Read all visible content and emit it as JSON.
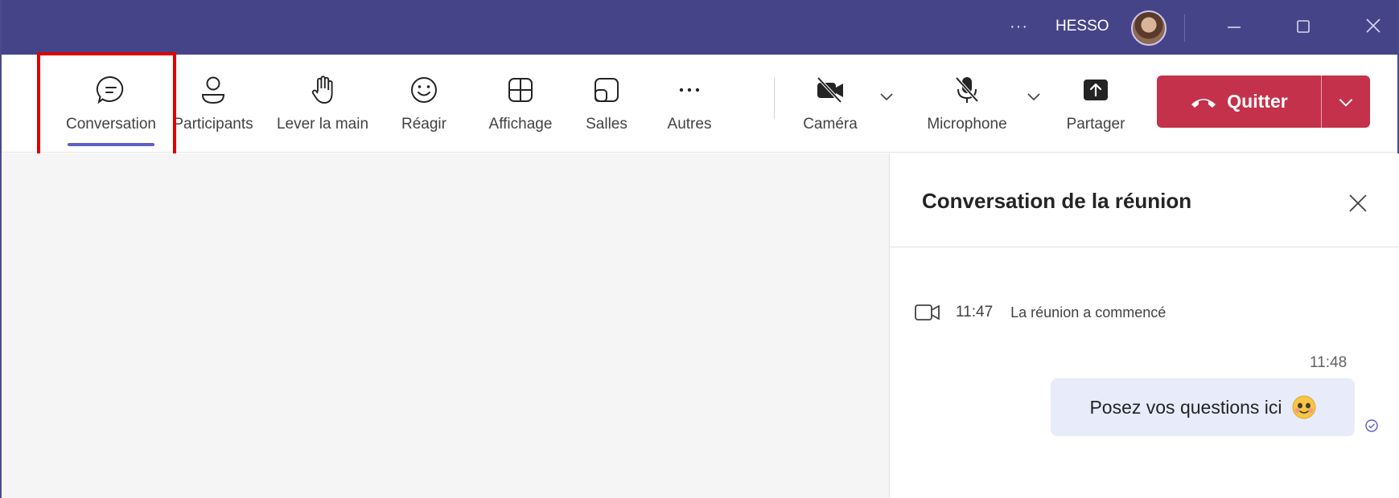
{
  "titlebar": {
    "more_label": "···",
    "org_label": "HESSO",
    "icons": [
      "more-icon",
      "avatar",
      "minimize-icon",
      "maximize-icon",
      "close-icon"
    ]
  },
  "toolbar": {
    "items": [
      {
        "id": "conversation",
        "label": "Conversation",
        "icon": "chat-icon",
        "active": true
      },
      {
        "id": "participants",
        "label": "Participants",
        "icon": "person-icon"
      },
      {
        "id": "raise-hand",
        "label": "Lever la main",
        "icon": "hand-icon"
      },
      {
        "id": "react",
        "label": "Réagir",
        "icon": "smiley-icon"
      },
      {
        "id": "view",
        "label": "Affichage",
        "icon": "grid-icon"
      },
      {
        "id": "rooms",
        "label": "Salles",
        "icon": "rooms-icon"
      },
      {
        "id": "more",
        "label": "Autres",
        "icon": "more-icon"
      },
      {
        "id": "camera",
        "label": "Caméra",
        "icon": "camera-off-icon"
      },
      {
        "id": "microphone",
        "label": "Microphone",
        "icon": "mic-off-icon"
      },
      {
        "id": "share",
        "label": "Partager",
        "icon": "share-icon"
      }
    ],
    "quit_label": "Quitter"
  },
  "colors": {
    "titlebar": "#464489",
    "accent": "#5b5fc7",
    "quit": "#c4314b",
    "highlight": "#e00000",
    "bubble": "#e8ebfa"
  },
  "chat": {
    "title": "Conversation de la réunion",
    "event_time": "11:47",
    "event_text": "La réunion a commencé",
    "message_time": "11:48",
    "message_text": "Posez vos questions ici"
  }
}
